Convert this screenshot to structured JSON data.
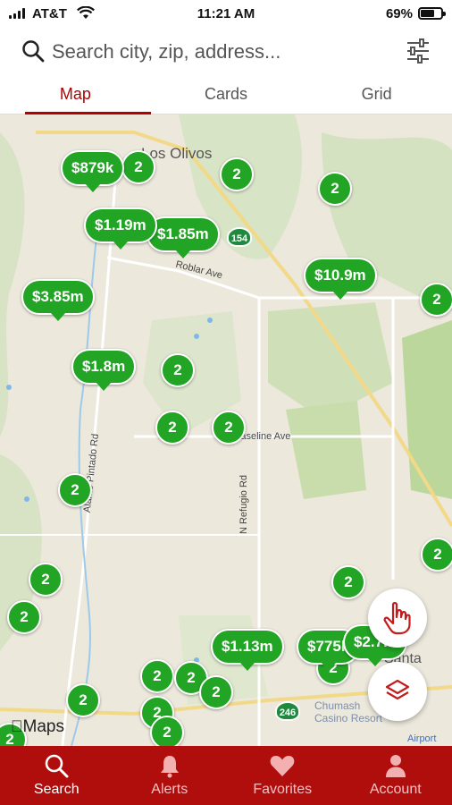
{
  "status_bar": {
    "carrier": "AT&T",
    "time": "11:21 AM",
    "battery": "69%",
    "battery_level": 0.69
  },
  "search": {
    "placeholder": "Search city, zip, address..."
  },
  "tabs": [
    {
      "label": "Map",
      "active": true
    },
    {
      "label": "Cards",
      "active": false
    },
    {
      "label": "Grid",
      "active": false
    }
  ],
  "map": {
    "street_labels": [
      "Roblar Ave",
      "Baseline Ave",
      "Alamo Pintado Rd",
      "N Refugio Rd",
      "Chumash Casino Resort",
      "Airport",
      "Santa Ynez",
      "Los Olivos"
    ],
    "highway_shields": [
      "154",
      "246"
    ],
    "attribution": "Maps",
    "price_pins": [
      "$879k",
      "$1.19m",
      "$1.85m",
      "$10.9m",
      "$3.85m",
      "$1.8m",
      "$1.13m",
      "$775k",
      "$2.7m"
    ],
    "cluster_pins": [
      "2",
      "2",
      "2",
      "2",
      "2",
      "2",
      "2",
      "2",
      "2",
      "2",
      "2",
      "2",
      "2",
      "2",
      "2",
      "2",
      "2",
      "2",
      "2",
      "2"
    ]
  },
  "bottom_nav": [
    {
      "label": "Search",
      "icon": "search-icon",
      "active": true
    },
    {
      "label": "Alerts",
      "icon": "bell-icon",
      "active": false
    },
    {
      "label": "Favorites",
      "icon": "heart-icon",
      "active": false
    },
    {
      "label": "Account",
      "icon": "person-icon",
      "active": false
    }
  ],
  "colors": {
    "brand": "#b00d0d",
    "pin": "#22a524"
  }
}
